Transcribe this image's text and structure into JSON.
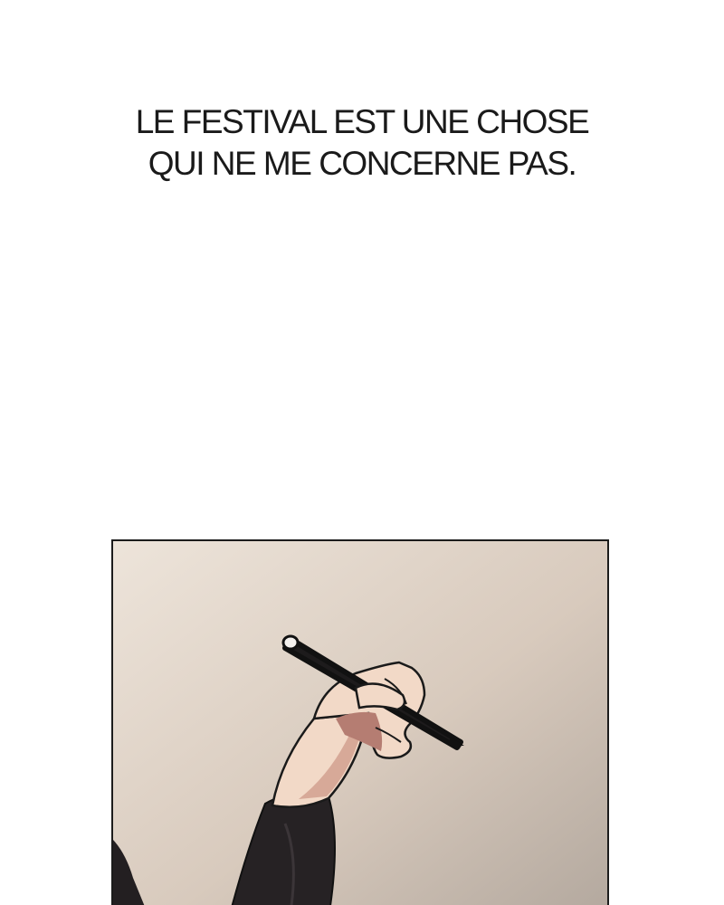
{
  "caption": {
    "line1": "LE FESTIVAL EST UNE CHOSE",
    "line2": "QUI NE ME CONCERNE PAS."
  },
  "panel": {
    "illustration": "hand-holding-marker",
    "colors": {
      "background_light": "#ece3d8",
      "background_dark": "#b6aba1",
      "skin": "#f2d9c7",
      "skin_shadow": "#b57d72",
      "sleeve": "#262224",
      "marker": "#1d1b1c"
    }
  }
}
